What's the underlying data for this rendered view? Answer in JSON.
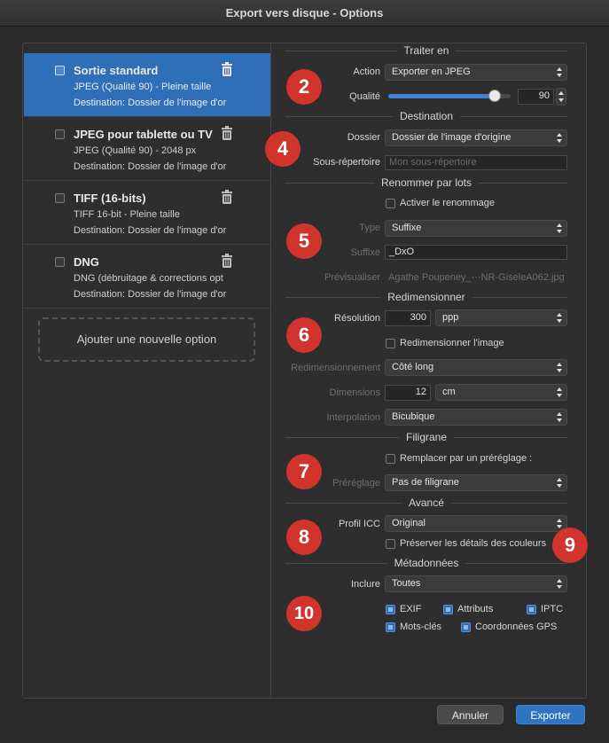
{
  "window": {
    "title": "Export vers disque - Options"
  },
  "presets": [
    {
      "name": "Sortie standard",
      "line2": "JPEG (Qualité 90) - Pleine taille",
      "line3": "Destination: Dossier de l'image d'or",
      "selected": true
    },
    {
      "name": "JPEG pour tablette ou TV",
      "line2": "JPEG (Qualité 90) - 2048 px",
      "line3": "Destination: Dossier de l'image d'or",
      "selected": false
    },
    {
      "name": "TIFF (16-bits)",
      "line2": "TIFF 16-bit - Pleine taille",
      "line3": "Destination: Dossier de l'image d'or",
      "selected": false
    },
    {
      "name": "DNG",
      "line2": "DNG (débruitage & corrections opt",
      "line3": "Destination: Dossier de l'image d'or",
      "selected": false
    }
  ],
  "add_option_label": "Ajouter une nouvelle option",
  "traiter": {
    "title": "Traiter en",
    "action_label": "Action",
    "action_value": "Exporter en JPEG",
    "quality_label": "Qualité",
    "quality_value": "90",
    "quality_fraction": 0.87
  },
  "destination": {
    "title": "Destination",
    "folder_label": "Dossier",
    "folder_value": "Dossier de l'image d'origine",
    "subfolder_label": "Sous-répertoire",
    "subfolder_placeholder": "Mon sous-répertoire"
  },
  "rename": {
    "title": "Renommer par lots",
    "enable_label": "Activer le renommage",
    "enable_checked": false,
    "type_label": "Type",
    "type_value": "Suffixe",
    "suffix_label": "Suffixe",
    "suffix_value": "_DxO",
    "preview_label": "Prévisualiser",
    "preview_value": "Agathe Poupeney_⋯NR-GiseleA062.jpg"
  },
  "resize": {
    "title": "Redimensionner",
    "resolution_label": "Résolution",
    "resolution_value": "300",
    "resolution_unit": "ppp",
    "resize_label": "Redimensionner l'image",
    "resize_checked": false,
    "mode_label": "Redimensionnement",
    "mode_value": "Côté long",
    "dimensions_label": "Dimensions",
    "dimensions_value": "12",
    "dimensions_unit": "cm",
    "interp_label": "Interpolation",
    "interp_value": "Bicubique"
  },
  "watermark": {
    "title": "Filigrane",
    "replace_label": "Remplacer par un préréglage :",
    "replace_checked": false,
    "preset_label": "Préréglage",
    "preset_value": "Pas de filigrane"
  },
  "advanced": {
    "title": "Avancé",
    "icc_label": "Profil ICC",
    "icc_value": "Original",
    "preserve_label": "Préserver les détails des couleurs",
    "preserve_checked": false
  },
  "metadata": {
    "title": "Métadonnées",
    "include_label": "Inclure",
    "include_value": "Toutes",
    "exif_label": "EXIF",
    "attributs_label": "Attributs",
    "iptc_label": "IPTC",
    "motscles_label": "Mots-clés",
    "gps_label": "Coordonnées GPS"
  },
  "badges": [
    "2",
    "4",
    "5",
    "6",
    "7",
    "8",
    "9",
    "10"
  ],
  "buttons": {
    "cancel": "Annuler",
    "export": "Exporter"
  },
  "colors": {
    "accent": "#2f74c3",
    "badge": "#d0342c",
    "selection": "#2f6fb7"
  }
}
